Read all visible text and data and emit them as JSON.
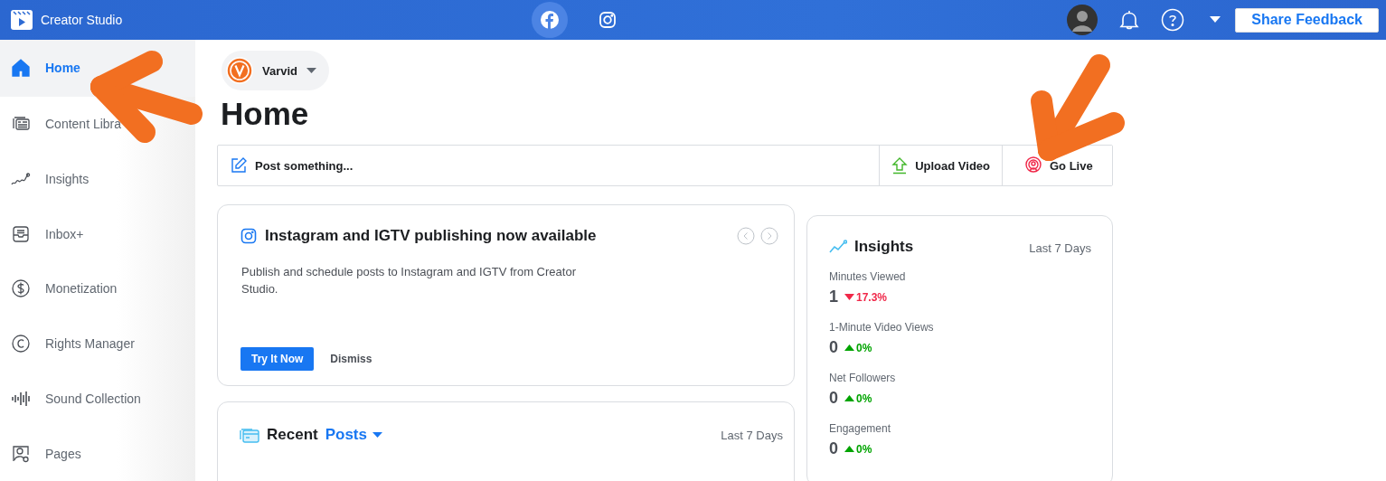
{
  "topbar": {
    "title": "Creator Studio",
    "platforms": [
      {
        "kind": "facebook",
        "selected": true
      },
      {
        "kind": "instagram",
        "selected": false
      }
    ],
    "button": "Share Feedback"
  },
  "sidebar": {
    "items": [
      {
        "kind": "home",
        "label": "Home",
        "selected": true
      },
      {
        "kind": "library",
        "label": "Content Libra",
        "selected": false
      },
      {
        "kind": "insights",
        "label": "Insights",
        "selected": false
      },
      {
        "kind": "inbox",
        "label": "Inbox+",
        "selected": false
      },
      {
        "kind": "money",
        "label": "Monetization",
        "selected": false
      },
      {
        "kind": "rights",
        "label": "Rights Manager",
        "selected": false
      },
      {
        "kind": "sound",
        "label": "Sound Collection",
        "selected": false
      },
      {
        "kind": "pages",
        "label": "Pages",
        "selected": false
      }
    ]
  },
  "page_selector": {
    "name": "Varvid"
  },
  "title": "Home",
  "composer": {
    "placeholder": "Post something...",
    "actions": [
      {
        "kind": "upload",
        "label": "Upload Video"
      },
      {
        "kind": "live",
        "label": "Go Live"
      }
    ]
  },
  "announcement": {
    "title": "Instagram and IGTV publishing now available",
    "body": "Publish and schedule posts to Instagram and IGTV from Creator Studio.",
    "primary": "Try It Now",
    "secondary": "Dismiss"
  },
  "recent": {
    "title": "Recent",
    "filter": "Posts",
    "period": "Last 7 Days"
  },
  "insights": {
    "title": "Insights",
    "period": "Last 7 Days",
    "metrics": [
      {
        "label": "Minutes Viewed",
        "value": "1",
        "change": "17.3%",
        "down": true
      },
      {
        "label": "1-Minute Video Views",
        "value": "0",
        "change": "0%",
        "down": false
      },
      {
        "label": "Net Followers",
        "value": "0",
        "change": "0%",
        "down": false
      },
      {
        "label": "Engagement",
        "value": "0",
        "change": "0%",
        "down": false
      }
    ]
  },
  "annotations": [
    {
      "kind": "arrow"
    },
    {
      "kind": "arrow"
    }
  ]
}
